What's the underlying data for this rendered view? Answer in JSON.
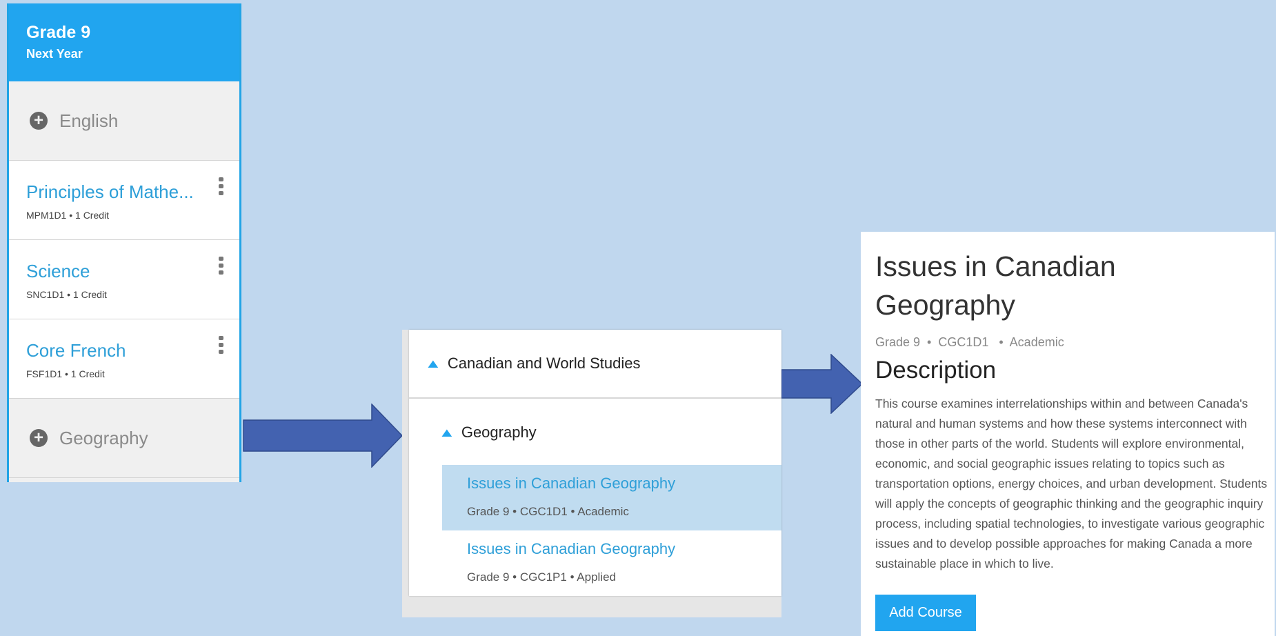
{
  "left_panel": {
    "grade_title": "Grade 9",
    "grade_subtitle": "Next Year",
    "slots": [
      {
        "type": "empty",
        "label": "English"
      },
      {
        "type": "course",
        "name": "Principles of Mathe...",
        "meta": "MPM1D1 • 1 Credit"
      },
      {
        "type": "course",
        "name": "Science",
        "meta": "SNC1D1 • 1 Credit"
      },
      {
        "type": "course",
        "name": "Core French",
        "meta": "FSF1D1 • 1 Credit"
      },
      {
        "type": "empty",
        "label": "Geography"
      }
    ]
  },
  "middle_panel": {
    "category": "Canadian and World Studies",
    "subcategory": "Geography",
    "options": [
      {
        "title": "Issues in Canadian Geography",
        "meta": "Grade 9 • CGC1D1 • Academic",
        "selected": true
      },
      {
        "title": "Issues in Canadian Geography",
        "meta": "Grade 9 • CGC1P1 • Applied",
        "selected": false
      }
    ]
  },
  "right_panel": {
    "title_line1": "Issues in Canadian",
    "title_line2": "Geography",
    "meta": "Grade 9  •  CGC1D1   •  Academic",
    "description_heading": "Description",
    "description_lines": [
      "This course examines interrelationships within and between Canada's",
      "natural and human systems and how these systems interconnect with",
      "those in other parts of the world. Students will explore environmental,",
      "economic, and social geographic issues relating to topics such as",
      "transportation options, energy choices, and urban development. Students",
      "will apply the concepts of geographic thinking and the geographic inquiry",
      "process, including spatial technologies, to investigate various geographic",
      "issues and to develop possible approaches for making Canada a more",
      "sustainable place in which to live."
    ],
    "add_button": "Add Course"
  },
  "colors": {
    "background": "#c0d7ee",
    "accent": "#21a5ef",
    "link": "#2e9fd8",
    "arrow": "#4362b0",
    "selected_row": "#c0dcf0"
  }
}
